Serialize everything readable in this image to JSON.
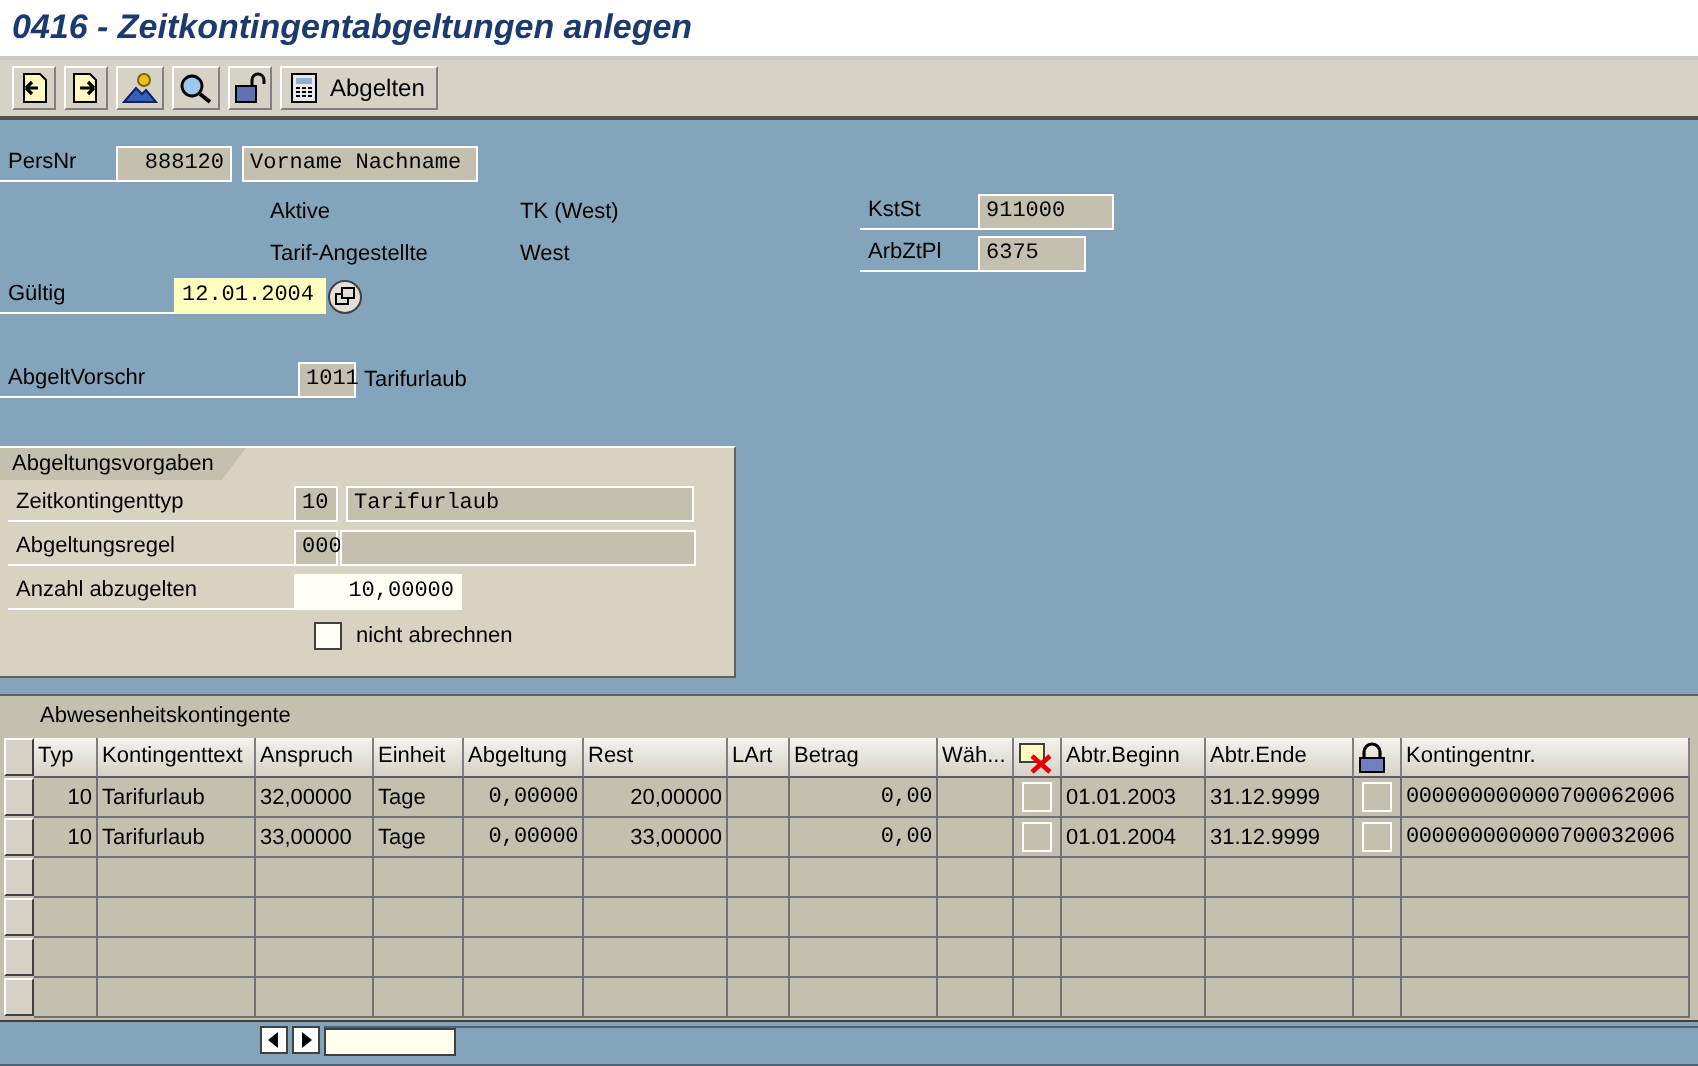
{
  "title": "0416 - Zeitkontingentabgeltungen anlegen",
  "toolbar": {
    "button_label": "Abgelten"
  },
  "header": {
    "persnr_label": "PersNr",
    "persnr": "888120",
    "name": "Vorname Nachname",
    "status_1": "Aktive",
    "region_1": "TK (West)",
    "status_2": "Tarif-Angestellte",
    "region_2": "West",
    "kstst": {
      "label": "KstSt",
      "value": "911000"
    },
    "arbztpl": {
      "label": "ArbZtPl",
      "value": "6375"
    },
    "gueltig": {
      "label": "Gültig",
      "value": "12.01.2004"
    },
    "abgeltvorschr": {
      "label": "AbgeltVorschr",
      "value": "1011",
      "text": "Tarifurlaub"
    }
  },
  "group": {
    "title": "Abgeltungsvorgaben",
    "zeitkontingenttyp": {
      "label": "Zeitkontingenttyp",
      "code": "10",
      "text": "Tarifurlaub"
    },
    "abgeltungsregel": {
      "label": "Abgeltungsregel",
      "code": "000"
    },
    "anzahl": {
      "label": "Anzahl abzugelten",
      "value": "10,00000"
    },
    "nicht_abrechnen": {
      "label": "nicht abrechnen",
      "checked": false
    }
  },
  "table": {
    "title": "Abwesenheitskontingente",
    "columns": [
      {
        "kind": "text",
        "label": "Typ"
      },
      {
        "kind": "text",
        "label": "Kontingenttext"
      },
      {
        "kind": "text",
        "label": "Anspruch"
      },
      {
        "kind": "text",
        "label": "Einheit"
      },
      {
        "kind": "text",
        "label": "Abgeltung"
      },
      {
        "kind": "text",
        "label": "Rest"
      },
      {
        "kind": "text",
        "label": "LArt"
      },
      {
        "kind": "text",
        "label": "Betrag"
      },
      {
        "kind": "text",
        "label": "Wäh..."
      },
      {
        "kind": "icon"
      },
      {
        "kind": "text",
        "label": "Abtr.Beginn"
      },
      {
        "kind": "text",
        "label": "Abtr.Ende"
      },
      {
        "kind": "icon"
      },
      {
        "kind": "text",
        "label": "Kontingentnr."
      }
    ],
    "rows": [
      {
        "typ": "10",
        "text": "Tarifurlaub",
        "anspruch": "32,00000",
        "einheit": "Tage",
        "abgeltung": "0,00000",
        "rest": "20,00000",
        "betrag": "0,00",
        "deleted": false,
        "beginn": "01.01.2003",
        "ende": "31.12.9999",
        "locked": false,
        "nr": "000000000000700062006"
      },
      {
        "typ": "10",
        "text": "Tarifurlaub",
        "anspruch": "33,00000",
        "einheit": "Tage",
        "abgeltung": "0,00000",
        "rest": "33,00000",
        "betrag": "0,00",
        "deleted": false,
        "beginn": "01.01.2004",
        "ende": "31.12.9999",
        "locked": false,
        "nr": "000000000000700032006"
      }
    ]
  }
}
